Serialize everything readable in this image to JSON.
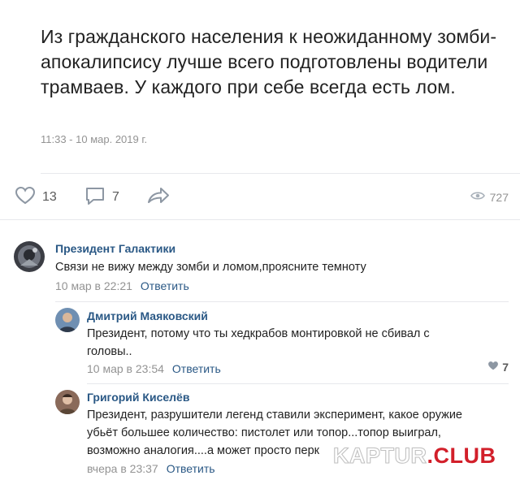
{
  "post": {
    "text": "Из гражданского населения к неожиданному зомби-апокалипсису лучше всего подготовлены водители трамваев. У каждого при себе всегда есть лом.",
    "date": "11:33 - 10 мар. 2019 г.",
    "likes": "13",
    "comments": "7",
    "views": "727"
  },
  "comments": [
    {
      "author": "Президент Галактики",
      "text": "Связи не вижу между зомби и ломом,проясните темноту",
      "date": "10 мар в 22:21",
      "reply": "Ответить"
    },
    {
      "author": "Дмитрий Маяковский",
      "text": "Президент, потому что ты хедкрабов монтировкой не сбивал с головы..",
      "date": "10 мар в 23:54",
      "reply": "Ответить",
      "likes": "7"
    },
    {
      "author": "Григорий Киселёв",
      "text": "Президент, разрушители легенд ставили эксперимент, какое оружие убьёт большее количество: пистолет или топор...топор выиграл, возможно аналогия....а может просто перк",
      "date": "вчера в 23:37",
      "reply": "Ответить"
    }
  ],
  "watermark": {
    "part1": "KAPTUR",
    "part2": ".CLUB"
  },
  "colors": {
    "link": "#2a5885",
    "muted": "#939393",
    "brand_red": "#d21f2a"
  }
}
